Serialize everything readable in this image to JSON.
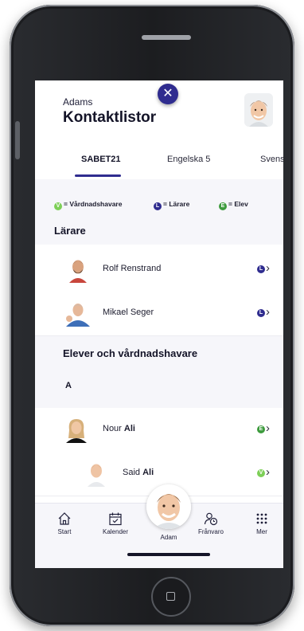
{
  "header": {
    "subtitle": "Adams",
    "title": "Kontaktlistor",
    "close_symbol": "✕"
  },
  "tabs": [
    {
      "label": "SABET21",
      "active": true
    },
    {
      "label": "Engelska 5",
      "active": false
    },
    {
      "label": "Svens",
      "active": false
    }
  ],
  "legend": {
    "guardian": {
      "letter": "V",
      "label": "= Vårdnadshavare",
      "color": "#7dcf57"
    },
    "teacher": {
      "letter": "L",
      "label": "= Lärare",
      "color": "#2f2c8f"
    },
    "student": {
      "letter": "E",
      "label": "= Elev",
      "color": "#3d9b3d"
    }
  },
  "sections": {
    "teachers_title": "Lärare",
    "students_title": "Elever och vårdnadshavare",
    "group_letter": "A"
  },
  "teachers": [
    {
      "name": "Rolf Renstrand",
      "badge": "L"
    },
    {
      "name": "Mikael Seger",
      "badge": "L"
    }
  ],
  "students": [
    {
      "first": "Nour",
      "last": "Ali",
      "badge": "E"
    },
    {
      "first": "Said",
      "last": "Ali",
      "badge": "V"
    }
  ],
  "chevron": "›",
  "tabbar": {
    "start": "Start",
    "calendar": "Kalender",
    "center": "Adam",
    "absence": "Frånvaro",
    "more": "Mer"
  },
  "colors": {
    "accent": "#2f2c8f",
    "guardian": "#7dcf57",
    "student": "#3d9b3d",
    "background": "#f6f6fa"
  },
  "icons": {
    "close": "close-icon",
    "start": "house-icon",
    "calendar": "calendar-icon",
    "absence": "person-clock-icon",
    "more": "grid-dots-icon",
    "row_arrow": "chevron-right-icon"
  }
}
